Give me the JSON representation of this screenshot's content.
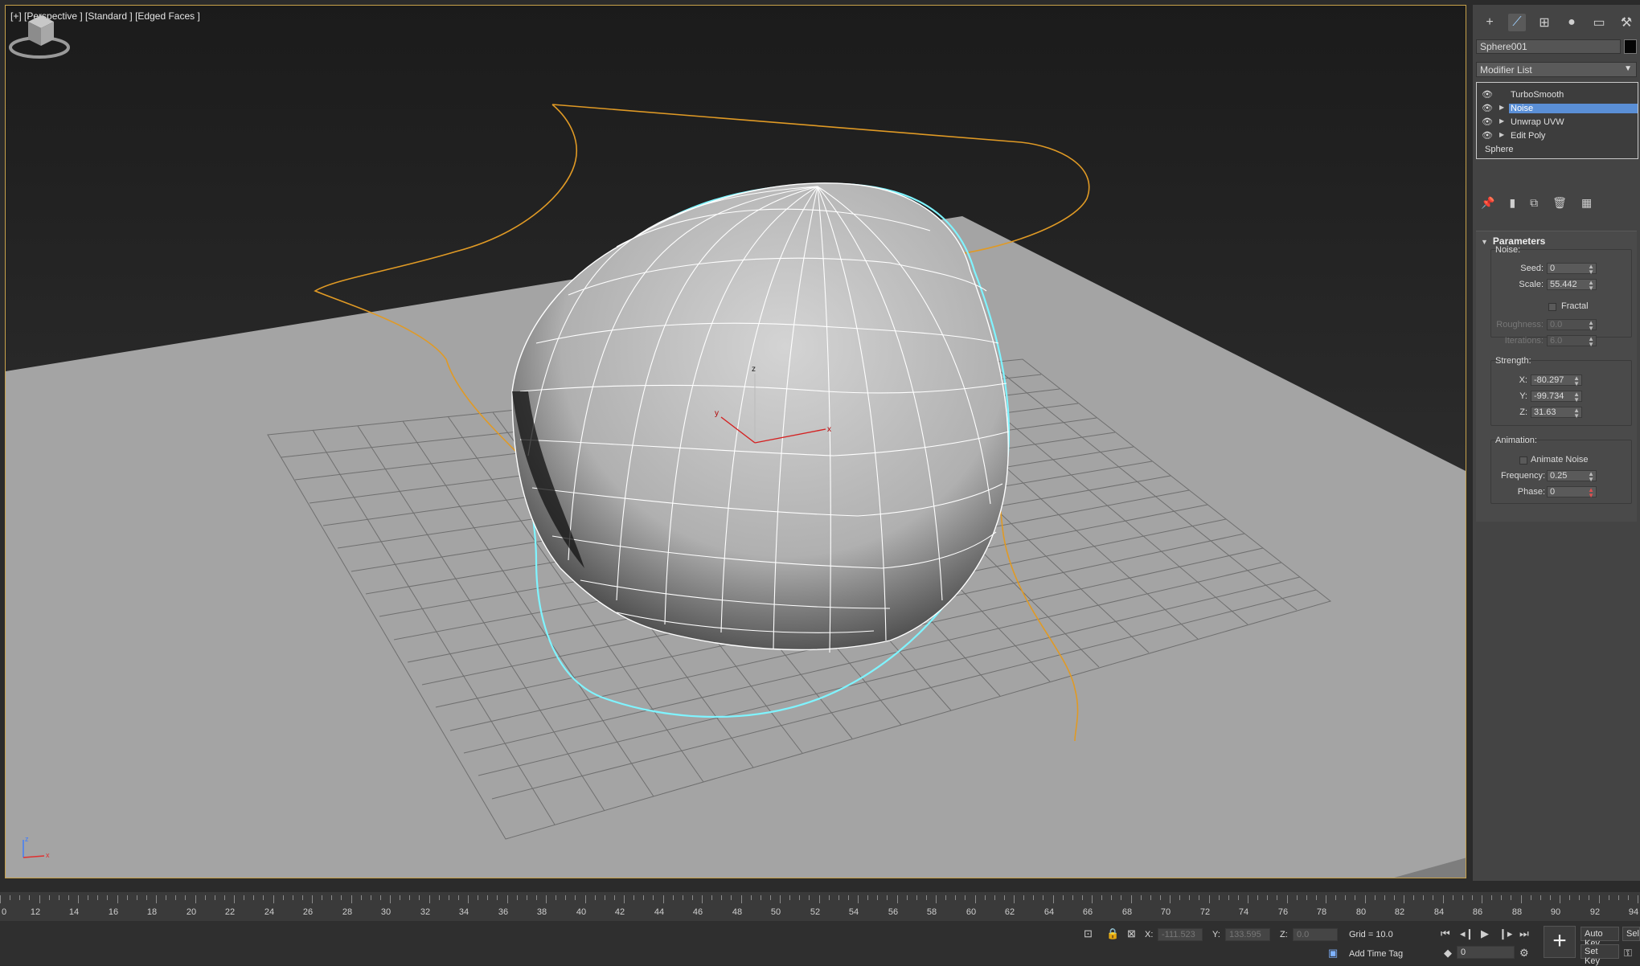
{
  "viewport": {
    "label": "[+] [Perspective ] [Standard ] [Edged Faces ]",
    "axis_labels": {
      "z": "z",
      "x": "x",
      "y": "y"
    }
  },
  "command_panel": {
    "tabs": [
      {
        "name": "create-tab",
        "icon": "plus-icon",
        "glyph": "+"
      },
      {
        "name": "modify-tab",
        "icon": "modify-icon",
        "glyph": "⟋"
      },
      {
        "name": "hierarchy-tab",
        "icon": "hierarchy-icon",
        "glyph": "⊞"
      },
      {
        "name": "motion-tab",
        "icon": "motion-icon",
        "glyph": "●"
      },
      {
        "name": "display-tab",
        "icon": "display-icon",
        "glyph": "▭"
      },
      {
        "name": "utilities-tab",
        "icon": "wrench-icon",
        "glyph": "⚒"
      }
    ],
    "object_name": "Sphere001",
    "object_color": "#050505",
    "modifier_list_label": "Modifier List",
    "stack": [
      {
        "label": "TurboSmooth",
        "eye": true,
        "expand": false,
        "selected": false
      },
      {
        "label": "Noise",
        "eye": true,
        "expand": true,
        "selected": true
      },
      {
        "label": "Unwrap UVW",
        "eye": true,
        "expand": true,
        "selected": false
      },
      {
        "label": "Edit Poly",
        "eye": true,
        "expand": true,
        "selected": false
      },
      {
        "label": "Sphere",
        "eye": false,
        "expand": false,
        "selected": false
      }
    ],
    "parameters": {
      "title": "Parameters",
      "noise_group": "Noise:",
      "seed_label": "Seed:",
      "seed": "0",
      "scale_label": "Scale:",
      "scale": "55.442",
      "fractal_label": "Fractal",
      "roughness_label": "Roughness:",
      "roughness": "0.0",
      "iterations_label": "Iterations:",
      "iterations": "6.0",
      "strength_group": "Strength:",
      "x_label": "X:",
      "x": "-80.297",
      "y_label": "Y:",
      "y": "-99.734",
      "z_label": "Z:",
      "z": "31.63",
      "animation_group": "Animation:",
      "animate_noise_label": "Animate Noise",
      "frequency_label": "Frequency:",
      "frequency": "0.25",
      "phase_label": "Phase:",
      "phase": "0"
    }
  },
  "timeline": {
    "ticks": [
      "0",
      "12",
      "14",
      "16",
      "18",
      "20",
      "22",
      "24",
      "26",
      "28",
      "30",
      "32",
      "34",
      "36",
      "38",
      "40",
      "42",
      "44",
      "46",
      "48",
      "50",
      "52",
      "54",
      "56",
      "58",
      "60",
      "62",
      "64",
      "66",
      "68",
      "70",
      "72",
      "74",
      "76",
      "78",
      "80",
      "82",
      "84",
      "86",
      "88",
      "90",
      "92",
      "94"
    ]
  },
  "status": {
    "x_label": "X:",
    "x_value": "-111.523",
    "y_label": "Y:",
    "y_value": "133.595",
    "z_label": "Z:",
    "z_value": "0.0",
    "grid": "Grid = 10.0",
    "add_time_tag": "Add Time Tag",
    "auto_key": "Auto Key",
    "set_key": "Set Key",
    "sel": "Sel",
    "frame": "0"
  }
}
